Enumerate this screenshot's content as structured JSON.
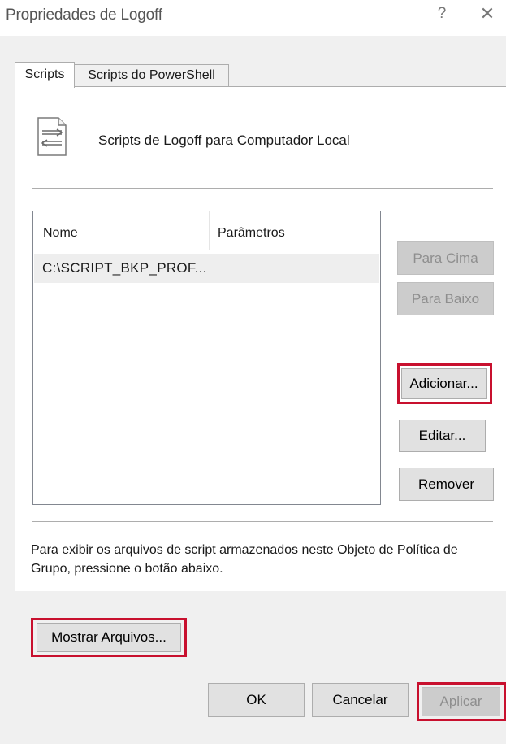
{
  "window": {
    "title": "Propriedades de Logoff",
    "help_glyph": "?",
    "close_glyph": "✕"
  },
  "tabs": [
    {
      "label": "Scripts",
      "selected": true
    },
    {
      "label": "Scripts do PowerShell",
      "selected": false
    }
  ],
  "header": {
    "icon": "script-document-icon",
    "text": "Scripts de Logoff para Computador Local"
  },
  "list": {
    "columns": [
      "Nome",
      "Parâmetros"
    ],
    "rows": [
      {
        "name": "C:\\SCRIPT_BKP_PROF...",
        "params": ""
      }
    ]
  },
  "side_buttons": {
    "up": "Para Cima",
    "down": "Para Baixo",
    "add": "Adicionar...",
    "edit": "Editar...",
    "remove": "Remover"
  },
  "info": {
    "text": "Para exibir os arquivos de script armazenados neste Objeto de Política de Grupo, pressione o botão abaixo."
  },
  "show_files_button": "Mostrar Arquivos...",
  "footer": {
    "ok": "OK",
    "cancel": "Cancelar",
    "apply": "Aplicar"
  },
  "colors": {
    "highlight": "#c8102e",
    "disabled_text": "#8e8e8e"
  }
}
